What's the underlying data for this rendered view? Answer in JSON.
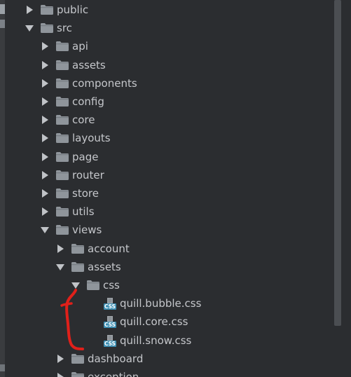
{
  "tree": {
    "rows": [
      {
        "label": "public",
        "type": "folder",
        "depth": 0,
        "state": "collapsed"
      },
      {
        "label": "src",
        "type": "folder",
        "depth": 0,
        "state": "expanded"
      },
      {
        "label": "api",
        "type": "folder",
        "depth": 1,
        "state": "collapsed"
      },
      {
        "label": "assets",
        "type": "folder",
        "depth": 1,
        "state": "collapsed"
      },
      {
        "label": "components",
        "type": "folder",
        "depth": 1,
        "state": "collapsed"
      },
      {
        "label": "config",
        "type": "folder",
        "depth": 1,
        "state": "collapsed"
      },
      {
        "label": "core",
        "type": "folder",
        "depth": 1,
        "state": "collapsed"
      },
      {
        "label": "layouts",
        "type": "folder",
        "depth": 1,
        "state": "collapsed"
      },
      {
        "label": "page",
        "type": "folder",
        "depth": 1,
        "state": "collapsed"
      },
      {
        "label": "router",
        "type": "folder",
        "depth": 1,
        "state": "collapsed"
      },
      {
        "label": "store",
        "type": "folder",
        "depth": 1,
        "state": "collapsed"
      },
      {
        "label": "utils",
        "type": "folder",
        "depth": 1,
        "state": "collapsed"
      },
      {
        "label": "views",
        "type": "folder",
        "depth": 1,
        "state": "expanded"
      },
      {
        "label": "account",
        "type": "folder",
        "depth": 2,
        "state": "collapsed"
      },
      {
        "label": "assets",
        "type": "folder",
        "depth": 2,
        "state": "expanded"
      },
      {
        "label": "css",
        "type": "folder",
        "depth": 3,
        "state": "expanded"
      },
      {
        "label": "quill.bubble.css",
        "type": "css-file",
        "depth": 4
      },
      {
        "label": "quill.core.css",
        "type": "css-file",
        "depth": 4
      },
      {
        "label": "quill.snow.css",
        "type": "css-file",
        "depth": 4
      },
      {
        "label": "dashboard",
        "type": "folder",
        "depth": 2,
        "state": "collapsed"
      },
      {
        "label": "exception",
        "type": "folder",
        "depth": 2,
        "state": "collapsed"
      }
    ]
  },
  "icons": {
    "folder": "folder-icon",
    "css_file": "css-file-icon",
    "arrow_collapsed": "chevron-right-icon",
    "arrow_expanded": "chevron-down-icon",
    "css_badge_text": "CSS"
  },
  "colors": {
    "background": "#2b2d30",
    "text": "#c5c7cb",
    "folder": "#8f959b",
    "css_badge": "#3d8fb3",
    "annotation": "#e0201a",
    "scrollbar": "#4b4e52"
  }
}
